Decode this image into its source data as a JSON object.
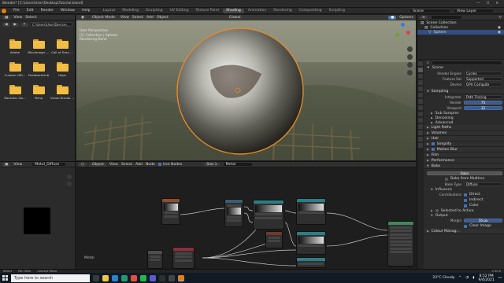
{
  "titlebar": {
    "title": "Blender* [C:\\Users\\User\\Desktop\\Tutorial.blend]"
  },
  "menubar": {
    "menus": [
      "File",
      "Edit",
      "Render",
      "Window",
      "Help"
    ],
    "workspaces": [
      "Layout",
      "Modeling",
      "Sculpting",
      "UV Editing",
      "Texture Paint",
      "Shading",
      "Animation",
      "Rendering",
      "Compositing",
      "Scripting"
    ],
    "active_workspace": "Shading",
    "scene_label": "Scene",
    "view_layer_label": "View Layer"
  },
  "filebrowser": {
    "menus": [
      "View",
      "Select"
    ],
    "path": "C:\\Users\\User\\Dev\\sm...",
    "folders": [
      "Adobe",
      "Blackmagic ...",
      "Call of Duty ...",
      "Custom Offi...",
      "FeedbackHub",
      "Hops",
      "Rockstar Ga...",
      "Temp",
      "Visual Studio ..."
    ]
  },
  "viewport": {
    "mode": "Object Mode",
    "menus": [
      "View",
      "Select",
      "Add",
      "Object"
    ],
    "shading_label": "Global",
    "info_lines": [
      "User Perspective",
      "(1) Collection | Sphere",
      "Rendering Done"
    ],
    "options_label": "Options"
  },
  "nodeeditor": {
    "header_items": [
      "Object",
      "View",
      "Select",
      "Add",
      "Node"
    ],
    "use_nodes_label": "Use Nodes",
    "slot_label": "Slot 1",
    "material_label": "Metal",
    "tree_label": "Metal"
  },
  "imageeditor": {
    "menus": [
      "View"
    ],
    "image_name": "Metal_Diffuse"
  },
  "outliner": {
    "rows": [
      {
        "label": "Scene Collection",
        "selected": false
      },
      {
        "label": "Collection",
        "selected": false
      },
      {
        "label": "Sphere",
        "selected": true
      }
    ]
  },
  "properties": {
    "scene_name": "Scene",
    "render_engine": {
      "label": "Render Engine",
      "value": "Cycles"
    },
    "feature_set": {
      "label": "Feature Set",
      "value": "Supported"
    },
    "device": {
      "label": "Device",
      "value": "GPU Compute"
    },
    "sampling_title": "Sampling",
    "integrator": {
      "label": "Integrator",
      "value": "Path Tracing"
    },
    "render_samples": {
      "label": "Render",
      "value": "75"
    },
    "viewport_samples": {
      "label": "Viewport",
      "value": "32"
    },
    "sub_sampling": [
      "Sub Samples",
      "Denoising",
      "Advanced"
    ],
    "sections": [
      "Light Paths",
      "Volumes",
      "Hair",
      "Simplify",
      "Motion Blur",
      "Film",
      "Performance",
      "Bake"
    ],
    "bake_button": "Bake",
    "bake_from_multires": "Bake from Multires",
    "bake_type": {
      "label": "Bake Type",
      "value": "Diffuse"
    },
    "influence_title": "Influence",
    "contributions_label": "Contributions",
    "contributions": [
      "Direct",
      "Indirect",
      "Color"
    ],
    "selected_to_active": "Selected to Active",
    "output_title": "Output",
    "margin": {
      "label": "Margin",
      "value": "16 px"
    },
    "clear_image": "Clear Image",
    "color_mgmt": "Colour Manag..."
  },
  "statusbar": {
    "items": [
      "Select",
      "Pan View",
      "Context Menu"
    ],
    "version": "2.90.0"
  },
  "taskbar": {
    "search_placeholder": "Type here to search",
    "weather": "23°C  Cloudy",
    "time": "8:52 PM",
    "date": "9/4/2021"
  },
  "colors": {
    "accent": "#e87d0d",
    "selection": "#4772b3"
  }
}
